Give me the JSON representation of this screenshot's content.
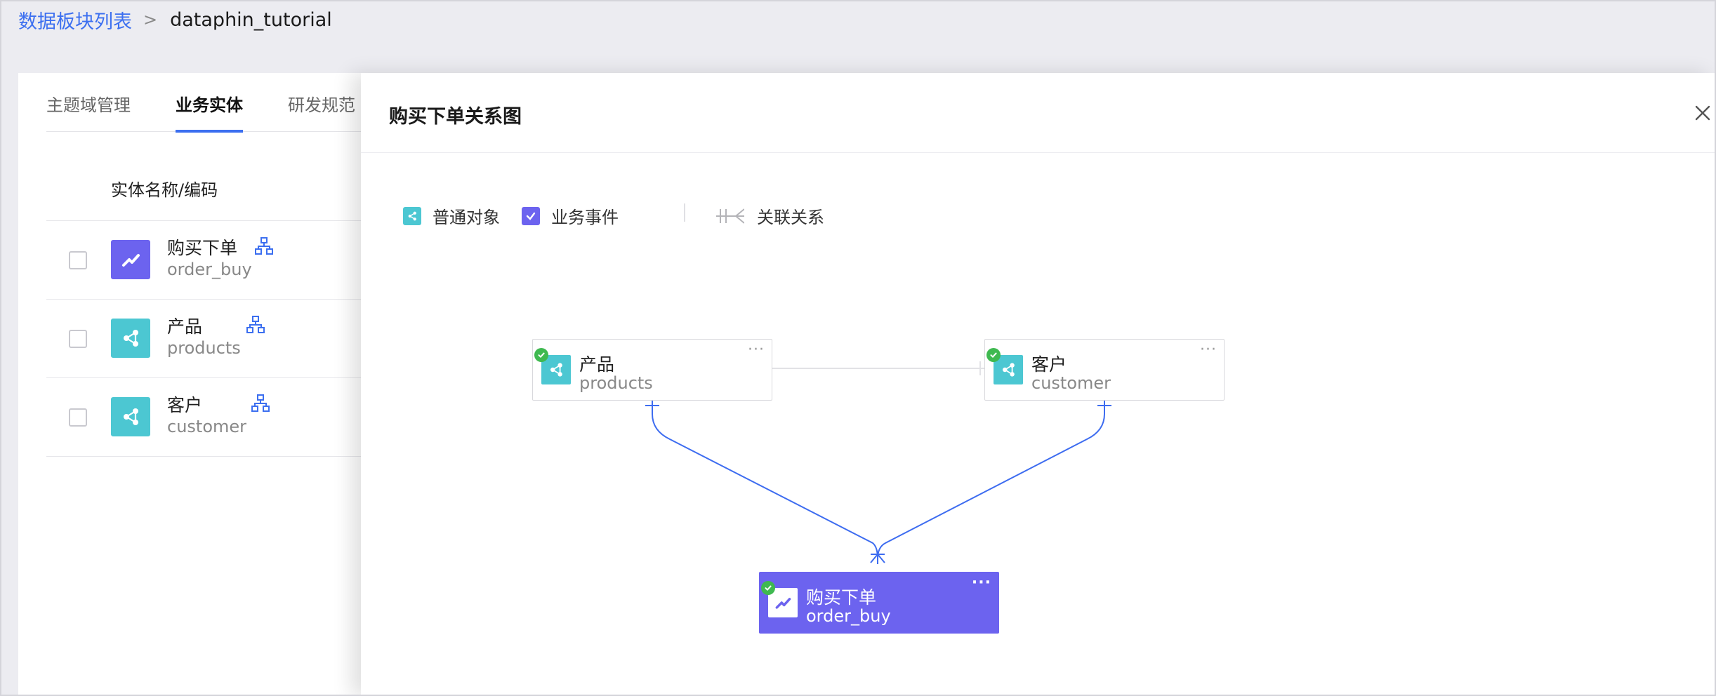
{
  "breadcrumb": {
    "link": "数据板块列表",
    "separator": ">",
    "current": "dataphin_tutorial"
  },
  "tabs": [
    {
      "label": "主题域管理",
      "active": false
    },
    {
      "label": "业务实体",
      "active": true
    },
    {
      "label": "研发规范（",
      "active": false
    }
  ],
  "entity_list": {
    "column_header": "实体名称/编码",
    "rows": [
      {
        "name": "购买下单",
        "code": "order_buy",
        "kind": "event",
        "icon": "check-trend-icon"
      },
      {
        "name": "产品",
        "code": "products",
        "kind": "object",
        "icon": "share-nodes-icon"
      },
      {
        "name": "客户",
        "code": "customer",
        "kind": "object",
        "icon": "share-nodes-icon"
      }
    ]
  },
  "drawer": {
    "title": "购买下单关系图",
    "close_icon": "close-icon",
    "legend": {
      "object_label": "普通对象",
      "event_label": "业务事件",
      "relation_label": "关联关系"
    },
    "nodes": [
      {
        "id": "products",
        "name": "产品",
        "code": "products",
        "kind": "object",
        "status": "published",
        "more": "···"
      },
      {
        "id": "customer",
        "name": "客户",
        "code": "customer",
        "kind": "object",
        "status": "published",
        "more": "···"
      },
      {
        "id": "order_buy",
        "name": "购买下单",
        "code": "order_buy",
        "kind": "event",
        "status": "published",
        "more": "···"
      }
    ]
  },
  "colors": {
    "accent_blue": "#3c6ff0",
    "event_purple": "#6c63ef",
    "object_teal": "#4cc7d2",
    "status_green": "#3fb950",
    "relation_line": "#3d6cf0"
  }
}
